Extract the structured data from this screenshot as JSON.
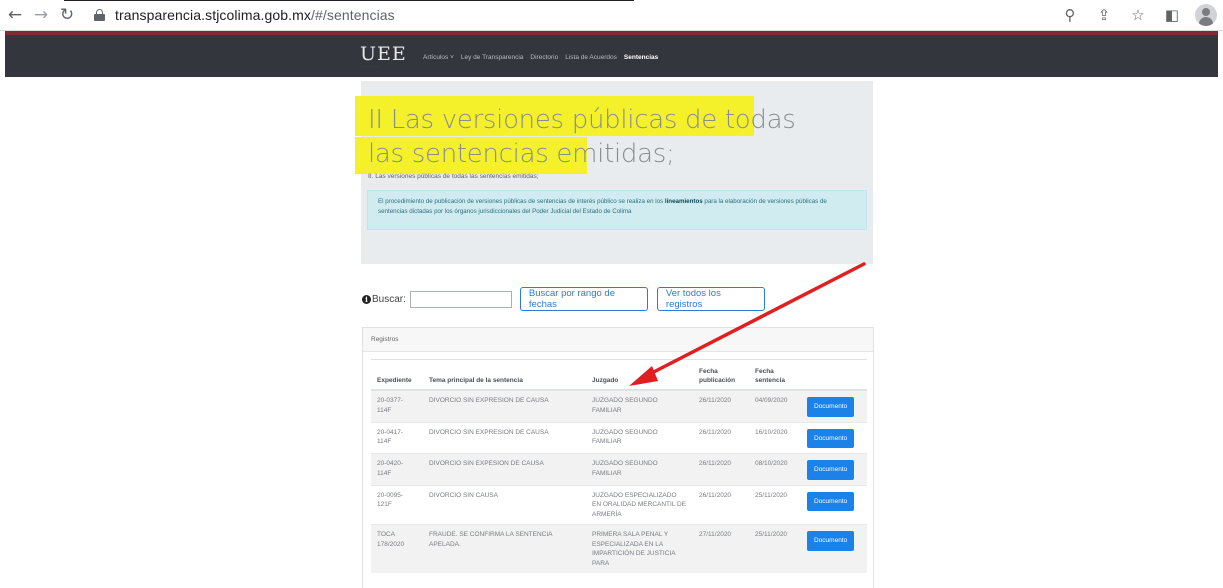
{
  "browser": {
    "url_host": "transparencia.stjcolima.gob.mx",
    "url_path": "/#/sentencias",
    "back_icon": "arrow-left-icon",
    "forward_icon": "arrow-right-icon",
    "reload_icon": "reload-icon"
  },
  "site": {
    "logo_text": "UEE",
    "nav": [
      "Artículos ˅",
      "Ley de Transparencia",
      "Directorio",
      "Lista de Acuerdos",
      "Sentencias"
    ],
    "header_accent": "#7d2b30"
  },
  "hero": {
    "title": "II Las versiones públicas de todas las sentencias emitidas;",
    "subtitle": "II. Las versiones públicas de todas las sentencias emitidas;",
    "alert_before": "El procedimiento de publicación de versiones públicas de sentencias de interés público se realiza en los ",
    "alert_bold": "lineamientos",
    "alert_after": " para la elaboración de versiones públicas de sentencias dictadas por los órganos jurisdiccionales del Poder Judicial del Estado de Colima"
  },
  "search": {
    "label": "Buscar:",
    "value": "",
    "range_button": "Buscar por rango de fechas",
    "all_button": "Ver todos los registros"
  },
  "card": {
    "header": "Registros"
  },
  "table": {
    "headers": [
      "Expediente",
      "Tema principal de la sentencia",
      "Juzgado",
      "Fecha publicación",
      "Fecha sentencia",
      ""
    ],
    "button_label": "Documento",
    "rows": [
      {
        "expediente": "20-0377-114F",
        "tema": "DIVORCIO SIN EXPRESION DE CAUSA",
        "juzgado": "JUZGADO SEGUNDO FAMILIAR",
        "publicacion": "26/11/2020",
        "sentencia": "04/09/2020"
      },
      {
        "expediente": "20-0417-114F",
        "tema": "DIVORCIO SIN EXPRESION DE CAUSA",
        "juzgado": "JUZGADO SEGUNDO FAMILIAR",
        "publicacion": "26/11/2020",
        "sentencia": "16/10/2020"
      },
      {
        "expediente": "20-0420-114F",
        "tema": "DIVORCIO SIN EXPESION DE CAUSA",
        "juzgado": "JUZGADO SEGUNDO FAMILIAR",
        "publicacion": "26/11/2020",
        "sentencia": "08/10/2020"
      },
      {
        "expediente": "20-0095-121F",
        "tema": "DIVORCIO SIN CAUSA",
        "juzgado": "JUZGADO ESPECIALIZADO EN ORALIDAD MERCANTIL DE ARMERÍA",
        "publicacion": "26/11/2020",
        "sentencia": "25/11/2020"
      },
      {
        "expediente": "TOCA 178/2020",
        "tema": "FRAUDE. SE CONFIRMA LA SENTENCIA APELADA.",
        "juzgado": "PRIMERA SALA PENAL Y ESPECIALIZADA EN LA IMPARTICIÓN DE JUSTICIA PARA",
        "publicacion": "27/11/2020",
        "sentencia": "25/11/2020"
      }
    ]
  },
  "colors": {
    "highlight": "#f4f12a",
    "annotation_arrow": "#e02020",
    "primary": "#1a82e8"
  }
}
